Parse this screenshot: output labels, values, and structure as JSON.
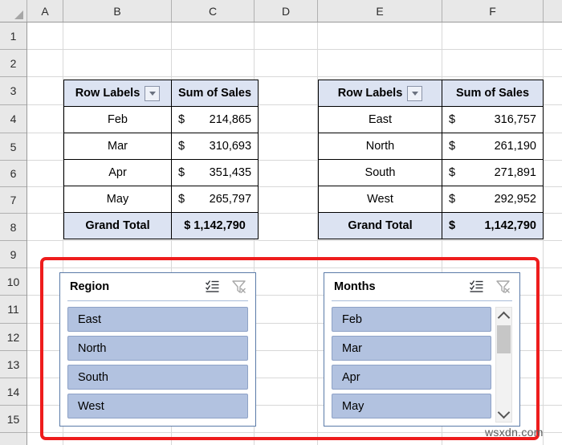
{
  "spreadsheet": {
    "column_headers": [
      "A",
      "B",
      "C",
      "D",
      "E",
      "F"
    ],
    "row_headers": [
      "1",
      "2",
      "3",
      "4",
      "5",
      "6",
      "7",
      "8",
      "9",
      "10",
      "11",
      "12",
      "13",
      "14",
      "15"
    ]
  },
  "pivot_months": {
    "headers": [
      "Row Labels",
      "Sum of Sales"
    ],
    "currency_symbol": "$",
    "rows": [
      {
        "label": "Feb",
        "value": "214,865"
      },
      {
        "label": "Mar",
        "value": "310,693"
      },
      {
        "label": "Apr",
        "value": "351,435"
      },
      {
        "label": "May",
        "value": "265,797"
      }
    ],
    "total_label": "Grand Total",
    "total_value": "$ 1,142,790"
  },
  "pivot_regions": {
    "headers": [
      "Row Labels",
      "Sum of Sales"
    ],
    "currency_symbol": "$",
    "rows": [
      {
        "label": "East",
        "value": "316,757"
      },
      {
        "label": "North",
        "value": "261,190"
      },
      {
        "label": "South",
        "value": "271,891"
      },
      {
        "label": "West",
        "value": "292,952"
      }
    ],
    "total_label": "Grand Total",
    "total_currency": "$",
    "total_value": "1,142,790"
  },
  "slicer_region": {
    "title": "Region",
    "multiselect_icon": "multi-select-icon",
    "clearfilter_icon": "clear-filter-icon",
    "items": [
      "East",
      "North",
      "South",
      "West"
    ],
    "has_scrollbar": false
  },
  "slicer_months": {
    "title": "Months",
    "multiselect_icon": "multi-select-icon",
    "clearfilter_icon": "clear-filter-icon",
    "items": [
      "Feb",
      "Mar",
      "Apr",
      "May"
    ],
    "has_scrollbar": true
  },
  "annotation": {
    "highlight_color": "#ee1c1c"
  },
  "watermark": {
    "text": "wsxdn.com"
  }
}
